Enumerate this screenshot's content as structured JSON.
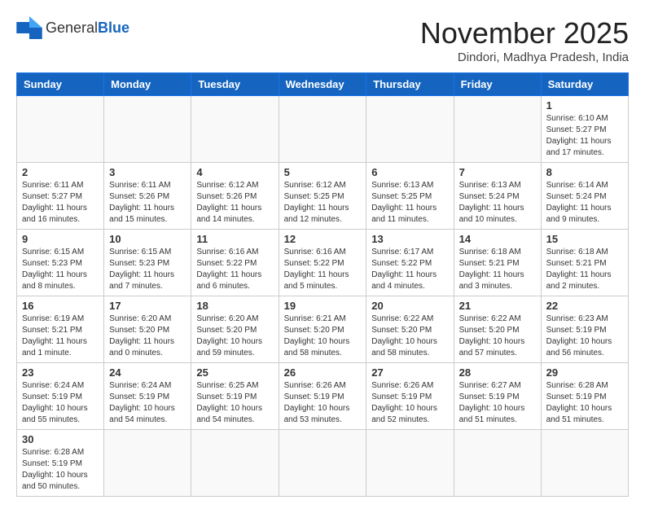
{
  "header": {
    "logo_general": "General",
    "logo_blue": "Blue",
    "month_title": "November 2025",
    "location": "Dindori, Madhya Pradesh, India"
  },
  "weekdays": [
    "Sunday",
    "Monday",
    "Tuesday",
    "Wednesday",
    "Thursday",
    "Friday",
    "Saturday"
  ],
  "weeks": [
    [
      {
        "day": "",
        "info": ""
      },
      {
        "day": "",
        "info": ""
      },
      {
        "day": "",
        "info": ""
      },
      {
        "day": "",
        "info": ""
      },
      {
        "day": "",
        "info": ""
      },
      {
        "day": "",
        "info": ""
      },
      {
        "day": "1",
        "info": "Sunrise: 6:10 AM\nSunset: 5:27 PM\nDaylight: 11 hours\nand 17 minutes."
      }
    ],
    [
      {
        "day": "2",
        "info": "Sunrise: 6:11 AM\nSunset: 5:27 PM\nDaylight: 11 hours\nand 16 minutes."
      },
      {
        "day": "3",
        "info": "Sunrise: 6:11 AM\nSunset: 5:26 PM\nDaylight: 11 hours\nand 15 minutes."
      },
      {
        "day": "4",
        "info": "Sunrise: 6:12 AM\nSunset: 5:26 PM\nDaylight: 11 hours\nand 14 minutes."
      },
      {
        "day": "5",
        "info": "Sunrise: 6:12 AM\nSunset: 5:25 PM\nDaylight: 11 hours\nand 12 minutes."
      },
      {
        "day": "6",
        "info": "Sunrise: 6:13 AM\nSunset: 5:25 PM\nDaylight: 11 hours\nand 11 minutes."
      },
      {
        "day": "7",
        "info": "Sunrise: 6:13 AM\nSunset: 5:24 PM\nDaylight: 11 hours\nand 10 minutes."
      },
      {
        "day": "8",
        "info": "Sunrise: 6:14 AM\nSunset: 5:24 PM\nDaylight: 11 hours\nand 9 minutes."
      }
    ],
    [
      {
        "day": "9",
        "info": "Sunrise: 6:15 AM\nSunset: 5:23 PM\nDaylight: 11 hours\nand 8 minutes."
      },
      {
        "day": "10",
        "info": "Sunrise: 6:15 AM\nSunset: 5:23 PM\nDaylight: 11 hours\nand 7 minutes."
      },
      {
        "day": "11",
        "info": "Sunrise: 6:16 AM\nSunset: 5:22 PM\nDaylight: 11 hours\nand 6 minutes."
      },
      {
        "day": "12",
        "info": "Sunrise: 6:16 AM\nSunset: 5:22 PM\nDaylight: 11 hours\nand 5 minutes."
      },
      {
        "day": "13",
        "info": "Sunrise: 6:17 AM\nSunset: 5:22 PM\nDaylight: 11 hours\nand 4 minutes."
      },
      {
        "day": "14",
        "info": "Sunrise: 6:18 AM\nSunset: 5:21 PM\nDaylight: 11 hours\nand 3 minutes."
      },
      {
        "day": "15",
        "info": "Sunrise: 6:18 AM\nSunset: 5:21 PM\nDaylight: 11 hours\nand 2 minutes."
      }
    ],
    [
      {
        "day": "16",
        "info": "Sunrise: 6:19 AM\nSunset: 5:21 PM\nDaylight: 11 hours\nand 1 minute."
      },
      {
        "day": "17",
        "info": "Sunrise: 6:20 AM\nSunset: 5:20 PM\nDaylight: 11 hours\nand 0 minutes."
      },
      {
        "day": "18",
        "info": "Sunrise: 6:20 AM\nSunset: 5:20 PM\nDaylight: 10 hours\nand 59 minutes."
      },
      {
        "day": "19",
        "info": "Sunrise: 6:21 AM\nSunset: 5:20 PM\nDaylight: 10 hours\nand 58 minutes."
      },
      {
        "day": "20",
        "info": "Sunrise: 6:22 AM\nSunset: 5:20 PM\nDaylight: 10 hours\nand 58 minutes."
      },
      {
        "day": "21",
        "info": "Sunrise: 6:22 AM\nSunset: 5:20 PM\nDaylight: 10 hours\nand 57 minutes."
      },
      {
        "day": "22",
        "info": "Sunrise: 6:23 AM\nSunset: 5:19 PM\nDaylight: 10 hours\nand 56 minutes."
      }
    ],
    [
      {
        "day": "23",
        "info": "Sunrise: 6:24 AM\nSunset: 5:19 PM\nDaylight: 10 hours\nand 55 minutes."
      },
      {
        "day": "24",
        "info": "Sunrise: 6:24 AM\nSunset: 5:19 PM\nDaylight: 10 hours\nand 54 minutes."
      },
      {
        "day": "25",
        "info": "Sunrise: 6:25 AM\nSunset: 5:19 PM\nDaylight: 10 hours\nand 54 minutes."
      },
      {
        "day": "26",
        "info": "Sunrise: 6:26 AM\nSunset: 5:19 PM\nDaylight: 10 hours\nand 53 minutes."
      },
      {
        "day": "27",
        "info": "Sunrise: 6:26 AM\nSunset: 5:19 PM\nDaylight: 10 hours\nand 52 minutes."
      },
      {
        "day": "28",
        "info": "Sunrise: 6:27 AM\nSunset: 5:19 PM\nDaylight: 10 hours\nand 51 minutes."
      },
      {
        "day": "29",
        "info": "Sunrise: 6:28 AM\nSunset: 5:19 PM\nDaylight: 10 hours\nand 51 minutes."
      }
    ],
    [
      {
        "day": "30",
        "info": "Sunrise: 6:28 AM\nSunset: 5:19 PM\nDaylight: 10 hours\nand 50 minutes."
      },
      {
        "day": "",
        "info": ""
      },
      {
        "day": "",
        "info": ""
      },
      {
        "day": "",
        "info": ""
      },
      {
        "day": "",
        "info": ""
      },
      {
        "day": "",
        "info": ""
      },
      {
        "day": "",
        "info": ""
      }
    ]
  ]
}
